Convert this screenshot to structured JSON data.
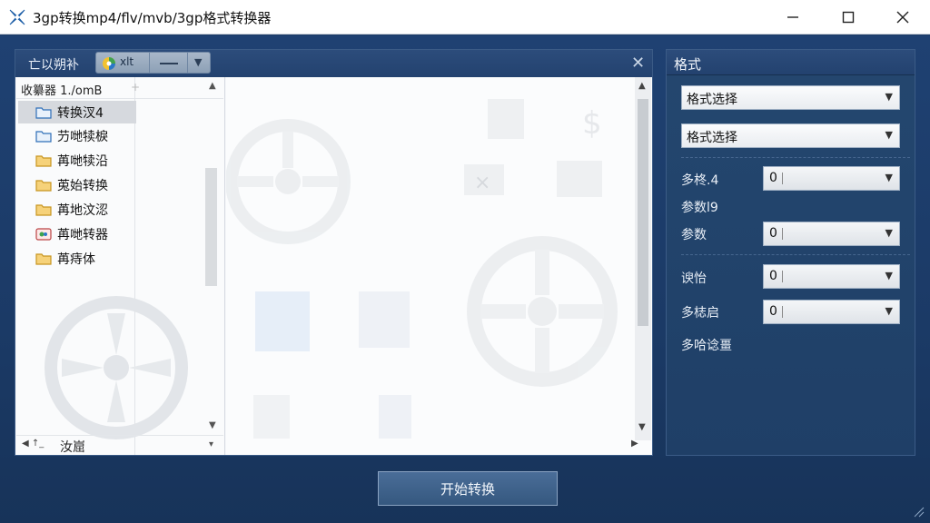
{
  "window": {
    "title": "3gp转换mp4/flv/mvb/3gp格式转换器",
    "minimize_icon": "minimize-icon",
    "maximize_icon": "maximize-icon",
    "close_icon": "close-icon"
  },
  "left_panel": {
    "title": "亡以朔补",
    "tab_label": "xlt",
    "tree_header": "收纂器 1./omB",
    "tree_items": [
      {
        "label": "转换汊4",
        "icon": "folder-blue-icon",
        "selected": true
      },
      {
        "label": "芀哋犊棙",
        "icon": "folder-blue-icon",
        "selected": false
      },
      {
        "label": "苒哋犊沿",
        "icon": "folder-yellow-icon",
        "selected": false
      },
      {
        "label": "莵始转换",
        "icon": "folder-yellow-icon",
        "selected": false
      },
      {
        "label": "苒地汶涊",
        "icon": "folder-yellow-icon",
        "selected": false
      },
      {
        "label": "苒哋转器",
        "icon": "image-file-icon",
        "selected": false
      },
      {
        "label": "苒痔体",
        "icon": "folder-yellow-icon",
        "selected": false
      }
    ],
    "tree_footer": "汝崫",
    "tree_footer_left": "◀ ↑_"
  },
  "right_panel": {
    "title": "格式",
    "format_select_1": "格式选择",
    "format_select_2": "格式选择",
    "params": [
      {
        "label": "多柊.4",
        "value": "0"
      },
      {
        "label": "参数l9",
        "value": null
      },
      {
        "label": "参数",
        "value": "0"
      },
      {
        "label": "谀怡",
        "value": "0"
      },
      {
        "label": "多梽启",
        "value": "0"
      },
      {
        "label": "多哈谂畺",
        "value": null
      }
    ]
  },
  "start_button": "开始转换",
  "colors": {
    "window_bg": "#1d3b66",
    "panel_head": "#2c4c7b",
    "selection": "#d6d9de"
  }
}
